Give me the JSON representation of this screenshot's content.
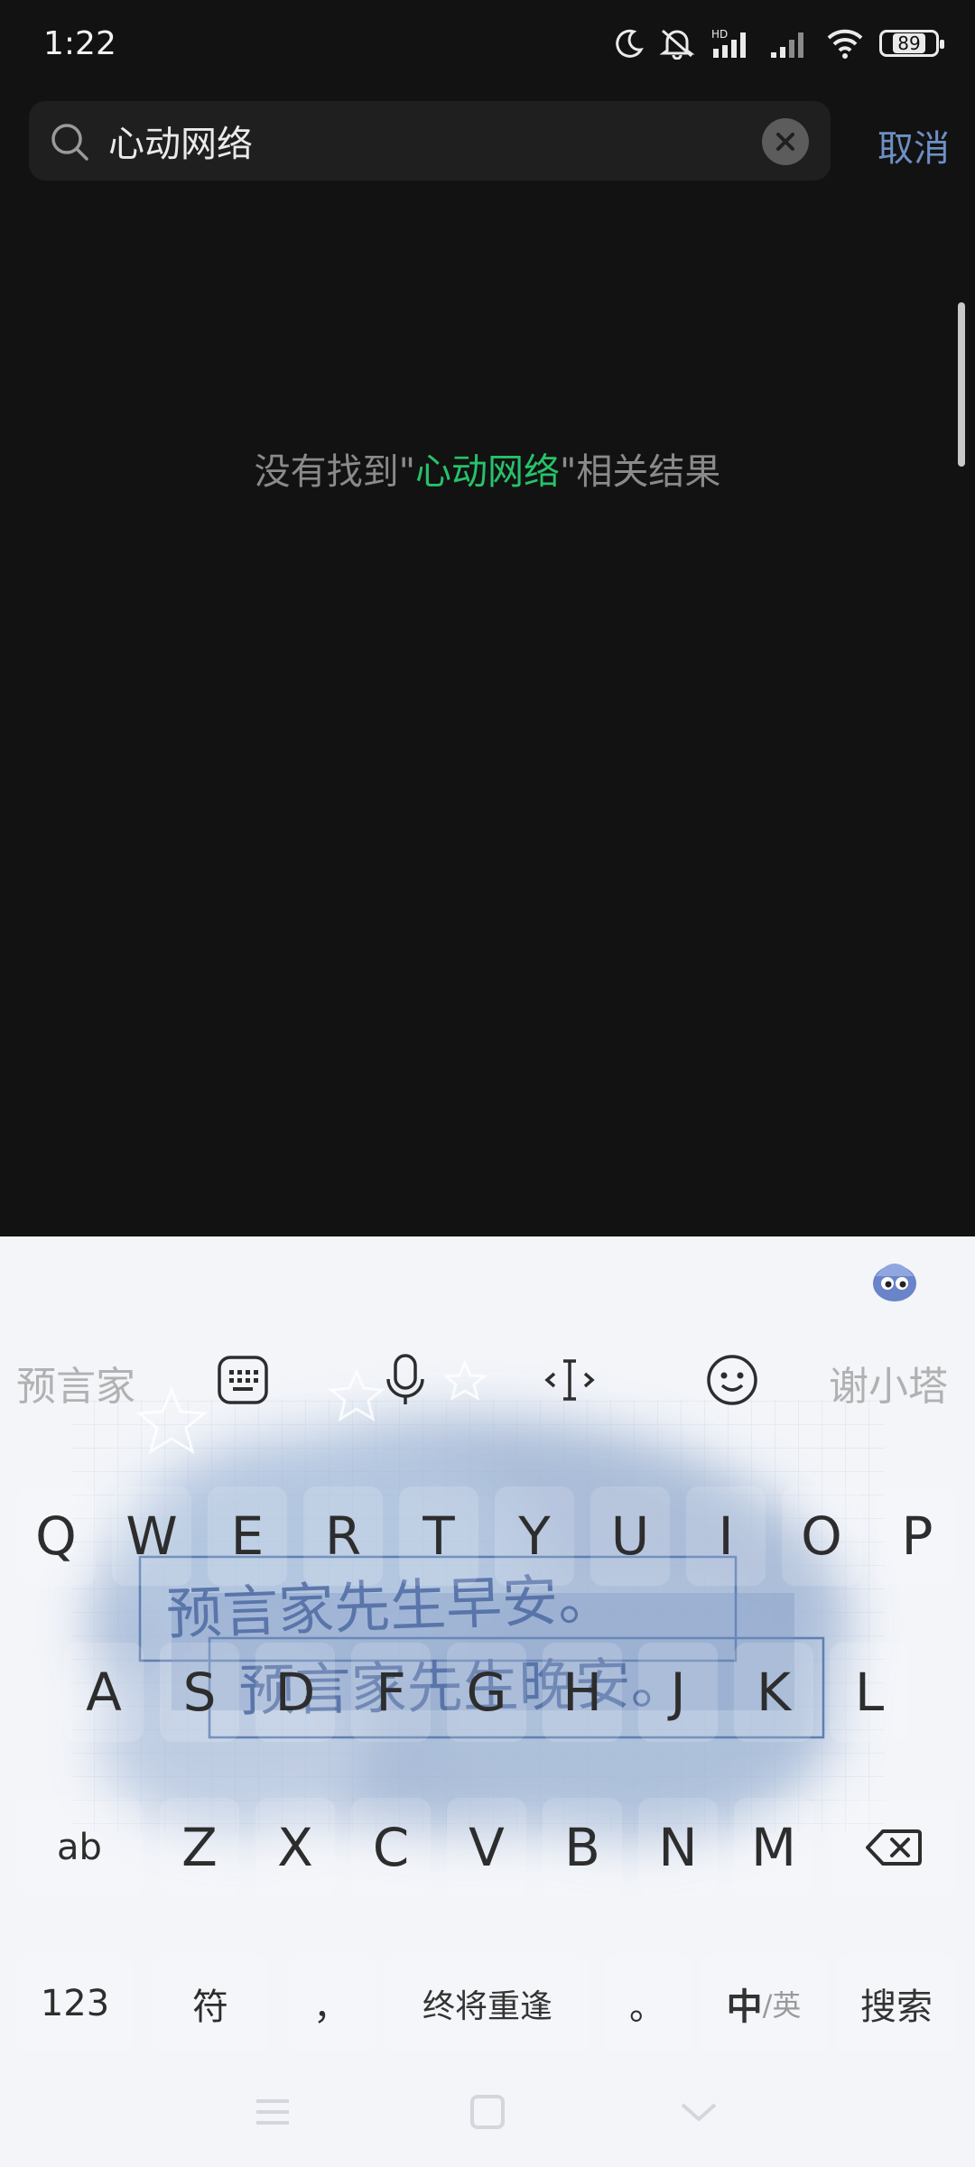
{
  "status_bar": {
    "time": "1:22",
    "hd_label": "HD",
    "battery": "89",
    "icons": [
      "moon-icon",
      "mute-bell-icon",
      "signal-hd-icon",
      "signal-icon",
      "wifi-icon",
      "battery-icon"
    ]
  },
  "search": {
    "query": "心动网络",
    "cancel_label": "取消",
    "icons": [
      "search-icon",
      "clear-icon"
    ]
  },
  "result": {
    "prefix": "没有找到\"",
    "keyword": "心动网络",
    "suffix": "\"相关结果"
  },
  "colors": {
    "background": "#121212",
    "keyword_green": "#27c26a",
    "cancel_blue": "#6d8fc4",
    "keyboard_bg": "#f3f5f9"
  },
  "keyboard": {
    "skin_text_line1": "预言家先生早安。",
    "skin_text_line2": "预言家先生晚安。",
    "toolbar": {
      "left_word": "预言家",
      "right_word": "谢小塔",
      "icons": [
        "keyboard-icon",
        "microphone-icon",
        "cursor-move-icon",
        "emoji-icon"
      ]
    },
    "row1": [
      "Q",
      "W",
      "E",
      "R",
      "T",
      "Y",
      "U",
      "I",
      "O",
      "P"
    ],
    "row2": [
      "A",
      "S",
      "D",
      "F",
      "G",
      "H",
      "J",
      "K",
      "L"
    ],
    "row3": [
      "Z",
      "X",
      "C",
      "V",
      "B",
      "N",
      "M"
    ],
    "shift_label": "ab",
    "row4": {
      "numbers": "123",
      "symbols": "符",
      "comma": "，",
      "space": "终将重逢",
      "period": "。",
      "lang_main": "中",
      "lang_sub": "/英",
      "search": "搜索"
    }
  },
  "navbar": {
    "icons": [
      "menu-icon",
      "home-icon",
      "back-chevron-icon"
    ]
  }
}
